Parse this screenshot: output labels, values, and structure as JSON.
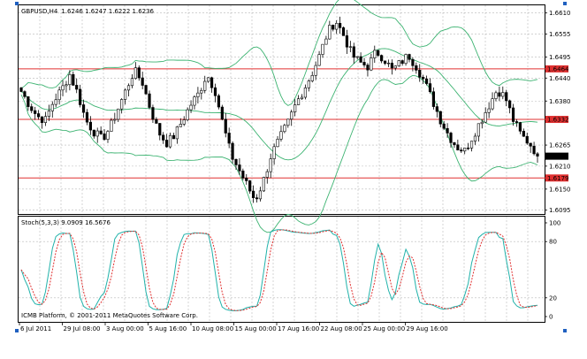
{
  "main_chart": {
    "header_symbol": "GBPUSD,H4",
    "header_ohlc": "1.6246 1.6247 1.6222 1.6236",
    "price_axis": [
      "1.6610",
      "1.6555",
      "1.6495",
      "1.6440",
      "1.6380",
      "1.6265",
      "1.6210",
      "1.6150",
      "1.6095"
    ],
    "level_lines": [
      {
        "label": "1.6464",
        "price": 1.6464
      },
      {
        "label": "1.6332",
        "price": 1.6332
      },
      {
        "label": "1.6179",
        "price": 1.6179
      }
    ],
    "current_price": {
      "label": "1.6236",
      "price": 1.6236
    },
    "colors": {
      "bollinger": "#3cb371",
      "level": "#e03030",
      "candle": "#000000",
      "grid": "#b8b8b8"
    }
  },
  "oscillator": {
    "header": "Stoch(5,3,3) 9.0909 16.5676",
    "axis": [
      "100",
      "80",
      "20",
      "0"
    ],
    "copyright": "ICMB Platform, © 2001-2011 MetaQuotes Software Corp.",
    "colors": {
      "main": "#20b2aa",
      "signal": "#e03030"
    }
  },
  "time_axis": [
    "6 Jul 2011",
    "29 Jul 08:00",
    "3 Aug 00:00",
    "5 Aug 16:00",
    "10 Aug 08:00",
    "15 Aug 00:00",
    "17 Aug 16:00",
    "22 Aug 08:00",
    "25 Aug 00:00",
    "29 Aug 16:00"
  ]
}
